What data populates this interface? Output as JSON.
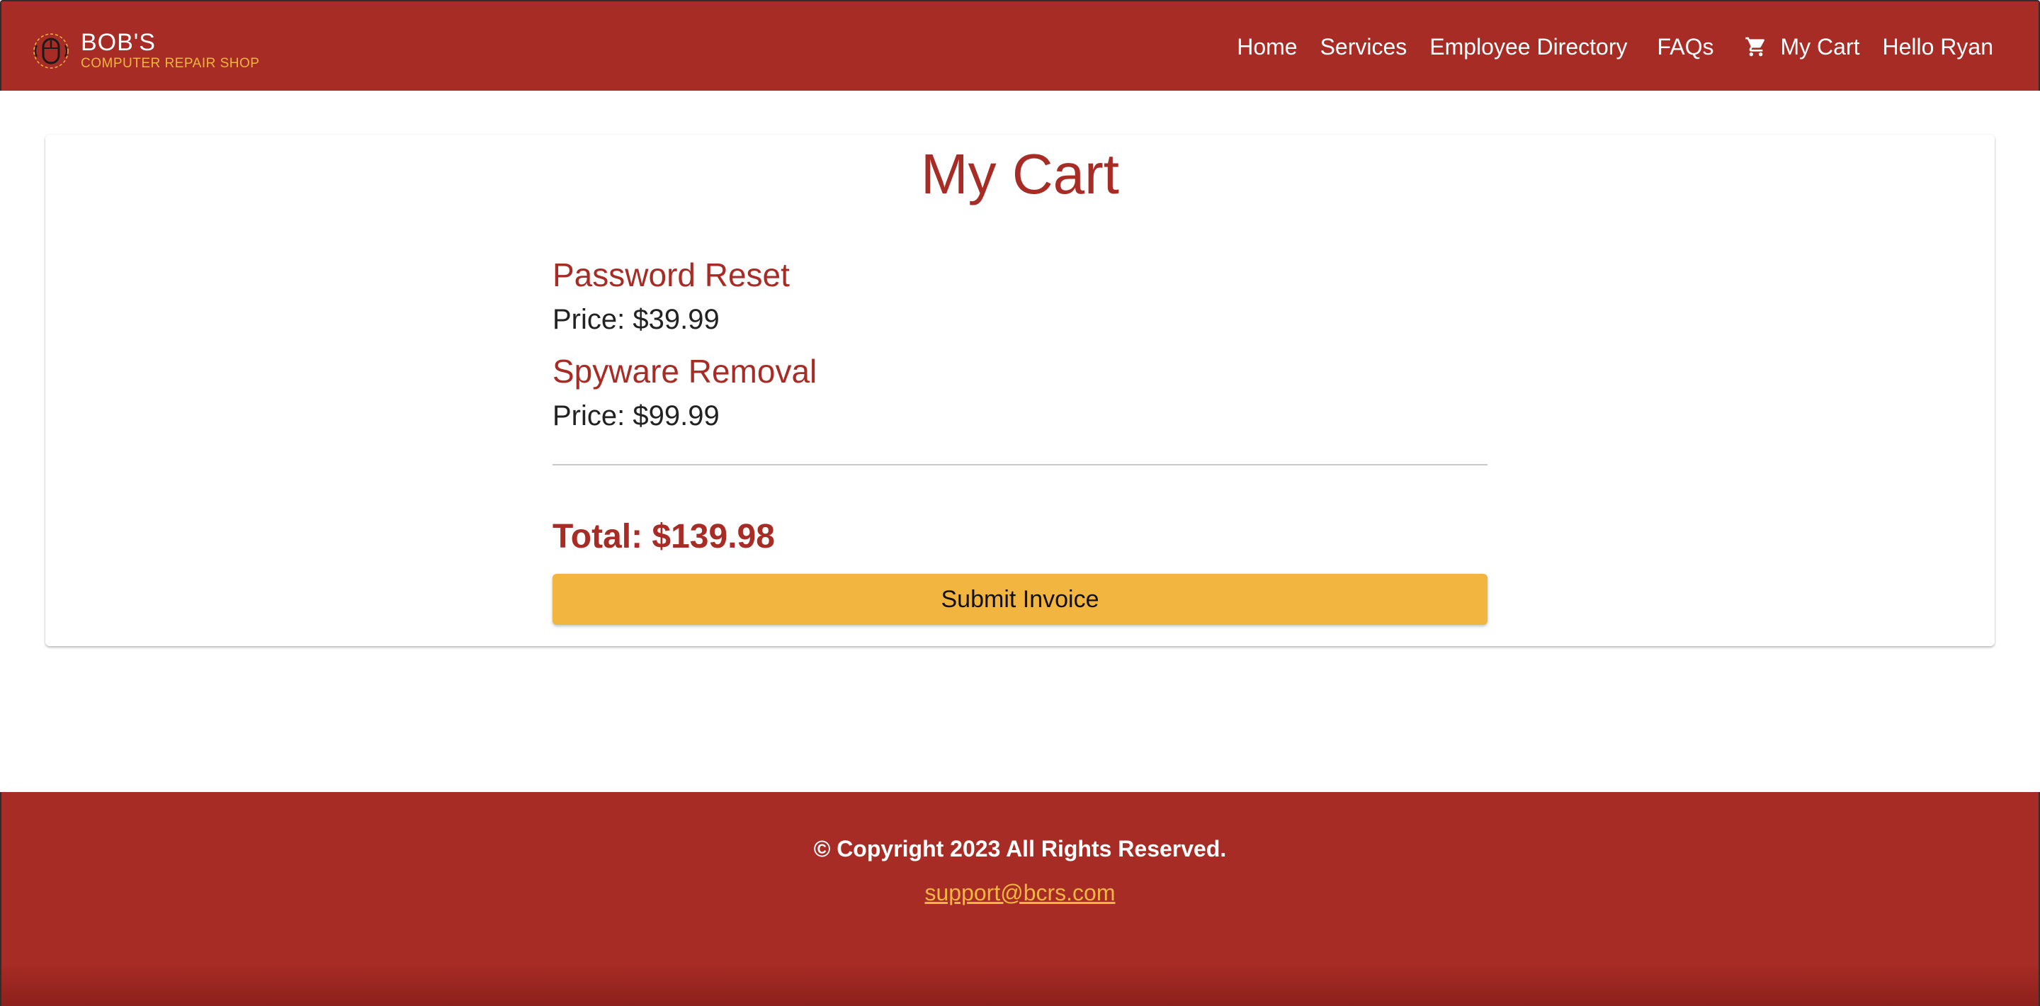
{
  "header": {
    "brand": {
      "name": "BOB'S",
      "subtitle": "COMPUTER REPAIR SHOP",
      "logo_icon": "mouse-logo-icon"
    },
    "nav": {
      "home": "Home",
      "services": "Services",
      "employee_directory": "Employee Directory",
      "faqs": "FAQs",
      "cart_icon": "shopping-cart-icon",
      "cart": "My Cart",
      "greeting": "Hello Ryan"
    }
  },
  "main": {
    "title": "My Cart",
    "items": [
      {
        "name": "Password Reset",
        "price_text": "Price: $39.99"
      },
      {
        "name": "Spyware Removal",
        "price_text": "Price: $99.99"
      }
    ],
    "total_text": "Total: $139.98",
    "submit_label": "Submit Invoice"
  },
  "footer": {
    "copyright": "© Copyright 2023 All Rights Reserved.",
    "email": "support@bcrs.com"
  },
  "colors": {
    "brand_red": "#a72c25",
    "accent_gold": "#f2b53f",
    "divider_gray": "#c8c8c8",
    "text_dark": "#222222"
  }
}
